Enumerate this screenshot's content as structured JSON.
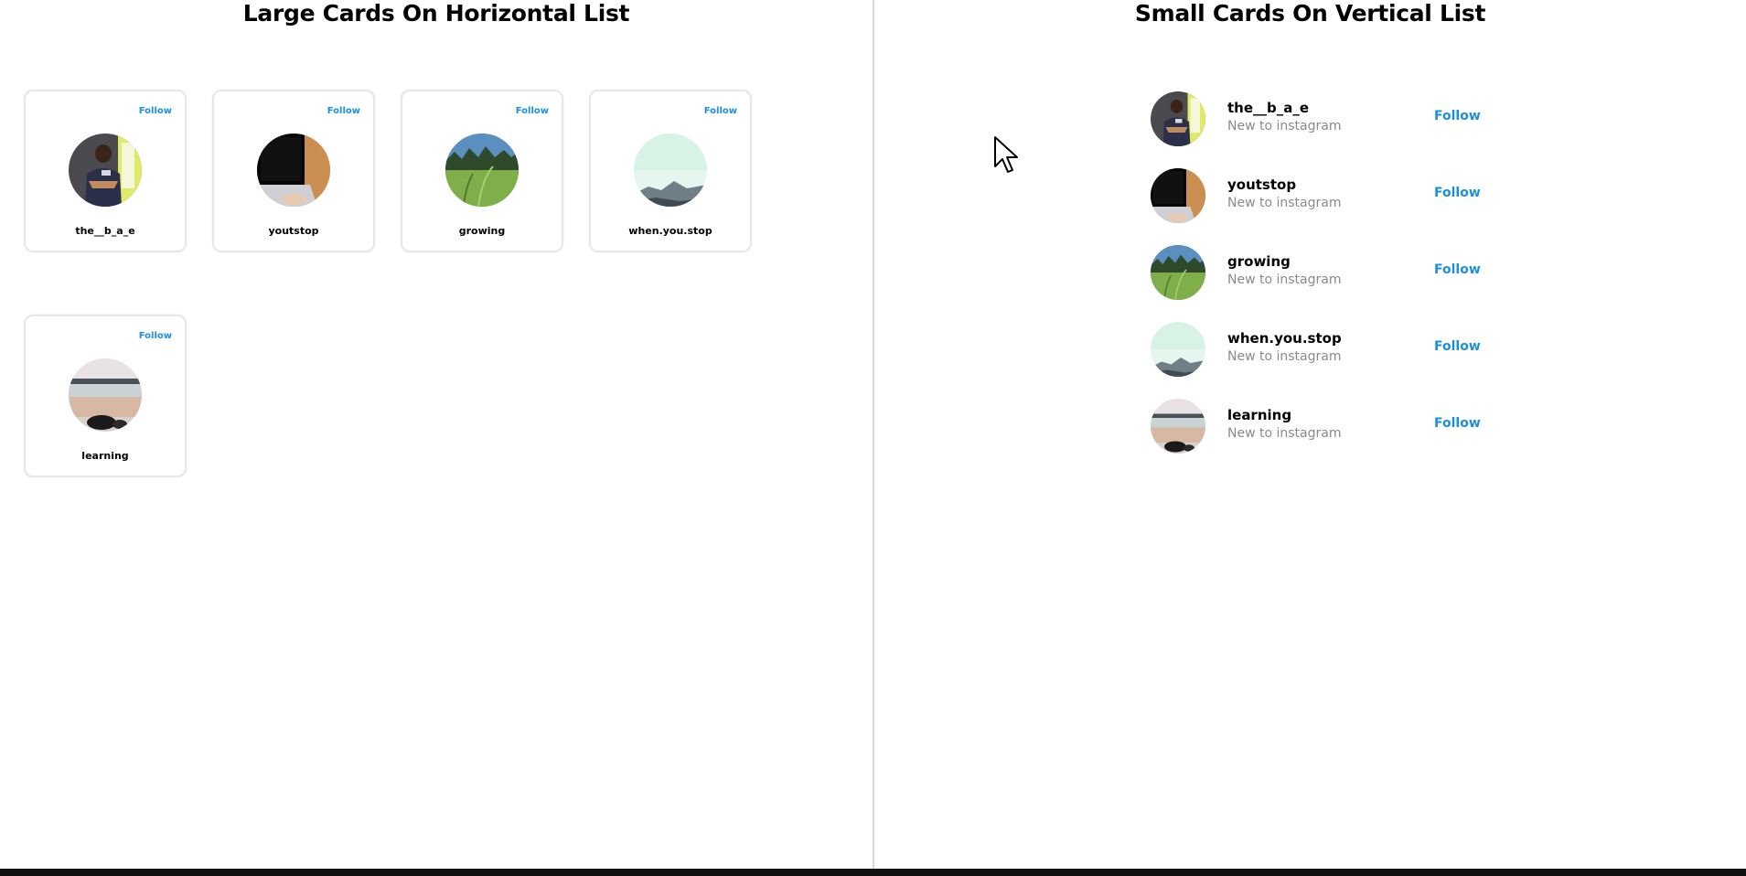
{
  "left": {
    "title": "Large Cards On Horizontal List",
    "cards": [
      {
        "name": "the__b_a_e",
        "follow": "Follow",
        "avatar": "person-avatar"
      },
      {
        "name": "youtstop",
        "follow": "Follow",
        "avatar": "laptop-avatar"
      },
      {
        "name": "growing",
        "follow": "Follow",
        "avatar": "grass-avatar"
      },
      {
        "name": "when.you.stop",
        "follow": "Follow",
        "avatar": "mist-avatar"
      },
      {
        "name": "learning",
        "follow": "Follow",
        "avatar": "beach-avatar"
      }
    ]
  },
  "right": {
    "title": "Small Cards On Vertical List",
    "rows": [
      {
        "name": "the__b_a_e",
        "subtitle": "New to instagram",
        "follow": "Follow"
      },
      {
        "name": "youtstop",
        "subtitle": "New to instagram",
        "follow": "Follow"
      },
      {
        "name": "growing",
        "subtitle": "New to instagram",
        "follow": "Follow"
      },
      {
        "name": "when.you.stop",
        "subtitle": "New to instagram",
        "follow": "Follow"
      },
      {
        "name": "learning",
        "subtitle": "New to instagram",
        "follow": "Follow"
      }
    ]
  },
  "colors": {
    "accent": "#1b8fe0",
    "subtitle": "#8a8a8a",
    "card_border": "#e6e6e6"
  }
}
